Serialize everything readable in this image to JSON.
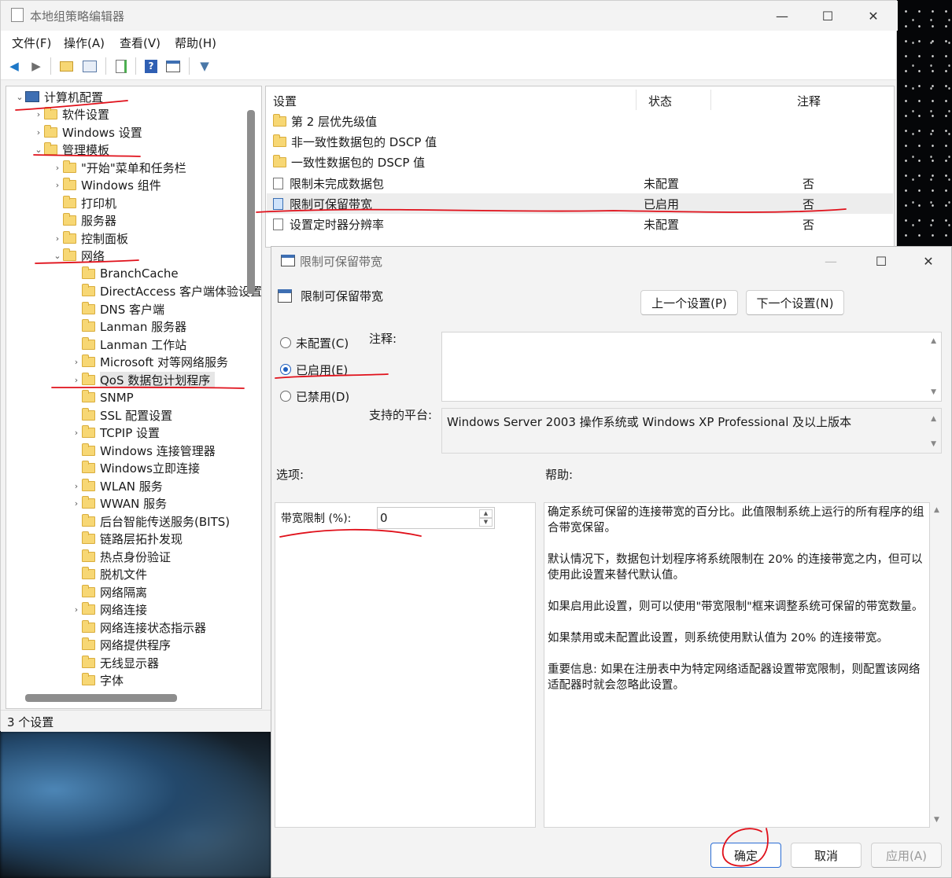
{
  "window": {
    "title": "本地组策略编辑器",
    "controls": {
      "minimize": "—",
      "maximize": "☐",
      "close": "✕"
    }
  },
  "menu": [
    "文件(F)",
    "操作(A)",
    "查看(V)",
    "帮助(H)"
  ],
  "toolbar": {
    "icons": [
      "back-icon",
      "forward-icon",
      "up-folder-icon",
      "show-hide-tree-icon",
      "export-list-icon",
      "help-icon",
      "properties-icon",
      "filter-icon"
    ],
    "glyphs": {
      "back": "◀",
      "forward": "▶",
      "help": "?",
      "filter": "▼"
    }
  },
  "tree": {
    "items": [
      {
        "label": "计算机配置",
        "level": 0,
        "chevron": "⌄",
        "icon": "computer-icon"
      },
      {
        "label": "软件设置",
        "level": 1,
        "chevron": "›"
      },
      {
        "label": "Windows 设置",
        "level": 1,
        "chevron": "›"
      },
      {
        "label": "管理模板",
        "level": 1,
        "chevron": "⌄"
      },
      {
        "label": "\"开始\"菜单和任务栏",
        "level": 2,
        "chevron": "›"
      },
      {
        "label": "Windows 组件",
        "level": 2,
        "chevron": "›"
      },
      {
        "label": "打印机",
        "level": 2,
        "chevron": ""
      },
      {
        "label": "服务器",
        "level": 2,
        "chevron": ""
      },
      {
        "label": "控制面板",
        "level": 2,
        "chevron": "›"
      },
      {
        "label": "网络",
        "level": 2,
        "chevron": "⌄"
      },
      {
        "label": "BranchCache",
        "level": 3,
        "chevron": ""
      },
      {
        "label": "DirectAccess 客户端体验设置",
        "level": 3,
        "chevron": ""
      },
      {
        "label": "DNS 客户端",
        "level": 3,
        "chevron": ""
      },
      {
        "label": "Lanman 服务器",
        "level": 3,
        "chevron": ""
      },
      {
        "label": "Lanman 工作站",
        "level": 3,
        "chevron": ""
      },
      {
        "label": "Microsoft 对等网络服务",
        "level": 3,
        "chevron": "›"
      },
      {
        "label": "QoS 数据包计划程序",
        "level": 3,
        "chevron": "›",
        "selected": true
      },
      {
        "label": "SNMP",
        "level": 3,
        "chevron": ""
      },
      {
        "label": "SSL 配置设置",
        "level": 3,
        "chevron": ""
      },
      {
        "label": "TCPIP 设置",
        "level": 3,
        "chevron": "›"
      },
      {
        "label": "Windows 连接管理器",
        "level": 3,
        "chevron": ""
      },
      {
        "label": "Windows立即连接",
        "level": 3,
        "chevron": ""
      },
      {
        "label": "WLAN 服务",
        "level": 3,
        "chevron": "›"
      },
      {
        "label": "WWAN 服务",
        "level": 3,
        "chevron": "›"
      },
      {
        "label": "后台智能传送服务(BITS)",
        "level": 3,
        "chevron": ""
      },
      {
        "label": "链路层拓扑发现",
        "level": 3,
        "chevron": ""
      },
      {
        "label": "热点身份验证",
        "level": 3,
        "chevron": ""
      },
      {
        "label": "脱机文件",
        "level": 3,
        "chevron": ""
      },
      {
        "label": "网络隔离",
        "level": 3,
        "chevron": ""
      },
      {
        "label": "网络连接",
        "level": 3,
        "chevron": "›"
      },
      {
        "label": "网络连接状态指示器",
        "level": 3,
        "chevron": ""
      },
      {
        "label": "网络提供程序",
        "level": 3,
        "chevron": ""
      },
      {
        "label": "无线显示器",
        "level": 3,
        "chevron": ""
      },
      {
        "label": "字体",
        "level": 3,
        "chevron": ""
      }
    ]
  },
  "list": {
    "headers": {
      "setting": "设置",
      "state": "状态",
      "comment": "注释"
    },
    "rows": [
      {
        "name": "第 2 层优先级值",
        "state": "",
        "comment": "",
        "type": "folder"
      },
      {
        "name": "非一致性数据包的 DSCP 值",
        "state": "",
        "comment": "",
        "type": "folder"
      },
      {
        "name": "一致性数据包的 DSCP 值",
        "state": "",
        "comment": "",
        "type": "folder"
      },
      {
        "name": "限制未完成数据包",
        "state": "未配置",
        "comment": "否",
        "type": "policy"
      },
      {
        "name": "限制可保留带宽",
        "state": "已启用",
        "comment": "否",
        "type": "policy",
        "selected": true
      },
      {
        "name": "设置定时器分辨率",
        "state": "未配置",
        "comment": "否",
        "type": "policy"
      }
    ]
  },
  "statusbar": {
    "text": "3 个设置"
  },
  "dialog": {
    "title": "限制可保留带宽",
    "heading": "限制可保留带宽",
    "controls": {
      "minimize": "—",
      "maximize": "☐",
      "close": "✕"
    },
    "prev_button": "上一个设置(P)",
    "next_button": "下一个设置(N)",
    "radios": {
      "not_configured": "未配置(C)",
      "enabled": "已启用(E)",
      "disabled": "已禁用(D)"
    },
    "comment_label": "注释:",
    "platform_label": "支持的平台:",
    "platform_value": "Windows Server 2003 操作系统或 Windows XP Professional 及以上版本",
    "options_label": "选项:",
    "help_label": "帮助:",
    "bandwidth_label": "带宽限制 (%):",
    "bandwidth_value": "0",
    "help_paragraphs": [
      "确定系统可保留的连接带宽的百分比。此值限制系统上运行的所有程序的组合带宽保留。",
      "默认情况下，数据包计划程序将系统限制在 20% 的连接带宽之内，但可以使用此设置来替代默认值。",
      "如果启用此设置，则可以使用\"带宽限制\"框来调整系统可保留的带宽数量。",
      "如果禁用或未配置此设置，则系统使用默认值为 20% 的连接带宽。",
      "重要信息: 如果在注册表中为特定网络适配器设置带宽限制，则配置该网络适配器时就会忽略此设置。"
    ],
    "ok_button": "确定",
    "cancel_button": "取消",
    "apply_button": "应用(A)"
  },
  "colors": {
    "annotation": "#e0101a",
    "accent": "#1f5fbf",
    "folder": "#f7d774"
  }
}
